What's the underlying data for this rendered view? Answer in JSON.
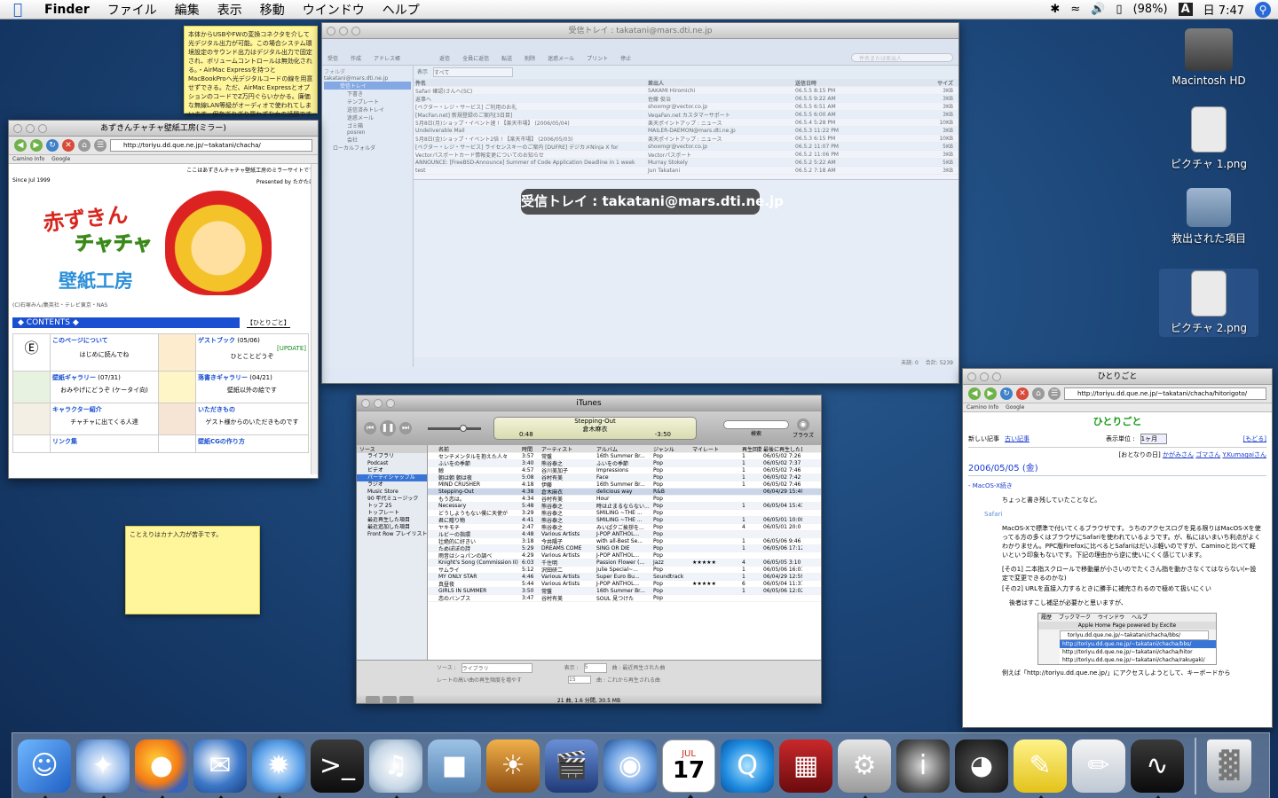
{
  "menubar": {
    "app_name": "Finder",
    "menus": [
      "ファイル",
      "編集",
      "表示",
      "移動",
      "ウインドウ",
      "ヘルプ"
    ],
    "battery": "(98%)",
    "input_mode": "A",
    "clock": "日 7:47"
  },
  "desktop_icons": [
    {
      "label": "Macintosh HD"
    },
    {
      "label": "ピクチャ 1.png"
    },
    {
      "label": "救出された項目"
    },
    {
      "label": "ピクチャ 2.png"
    }
  ],
  "sticky_top": {
    "text": "本体からUSBやFWの変換コネクタを介して光デジタル出力が可能。この場合システム環境設定のサウンド出力はデジタル出力で固定され、ボリュームコントロールは無効化される。・AirMac Expressを持つとMacBookProへ光デジタルコードの線を用意せずできる。ただ、AirMac ExpressとオプションのコードでZ万円ぐらいかかる。廉価な無線LAN等級がオーディオで使われてしまいます。保存ぎりぎり買わずな女の話題ですがが、そんなものです購入にはかなり後の残念です。"
  },
  "sticky_bottom": {
    "text": "ことえりはカナ入力が苦手です。"
  },
  "camino": {
    "title": "あずきんチャチャ壁紙工房(ミラー)",
    "url": "http://toriyu.dd.que.ne.jp/~takatani/chacha/",
    "bookmarks": [
      "Camino Info",
      "Google"
    ],
    "mirror_note": "ここはあずきんチャチャ壁紙工房のミラーサイトです",
    "since": "Since Jul 1999",
    "presented_by": "Presented by たかたに",
    "copyright": "(C)石塚みん/集英社・テレビ東京・NAS",
    "logo_line1": "赤ずきん",
    "logo_line2": "チャチャ",
    "logo_line3": "壁紙工房",
    "contents_label": "◆ CONTENTS ◆",
    "hitorigoto_link": "【ひとりごと】",
    "items": [
      {
        "title": "このページについて",
        "desc": "はじめに読んでね",
        "date": ""
      },
      {
        "title": "ゲストブック",
        "desc": "ひとことどうぞ",
        "date": "(05/06)",
        "badge": "[UPDATE]"
      },
      {
        "title": "壁紙ギャラリー",
        "desc": "おみやげにどうぞ (ケータイ向)",
        "date": "(07/31)"
      },
      {
        "title": "落書きギャラリー",
        "desc": "壁紙以外の絵です",
        "date": "(04/21)"
      },
      {
        "title": "キャラクター紹介",
        "desc": "チャチャに出てくる人達",
        "date": ""
      },
      {
        "title": "いただきもの",
        "desc": "ゲスト様からのいただきものです",
        "date": ""
      },
      {
        "title": "リンク集",
        "desc": "",
        "date": ""
      },
      {
        "title": "壁紙CGの作り方",
        "desc": "",
        "date": ""
      }
    ]
  },
  "mail": {
    "title": "受信トレイ : takatani@mars.dti.ne.jp",
    "toolbar": [
      "受信",
      "作成",
      "アドレス帳",
      "返信",
      "全員に返信",
      "転送",
      "削除",
      "迷惑メール",
      "プリント",
      "停止"
    ],
    "search_placeholder": "件名または差出人",
    "show_label": "表示",
    "show_value": "すべて",
    "folders": [
      "フォルダ",
      "takatani@mars.dti.ne.jp",
      "受信トレイ",
      "下書き",
      "テンプレート",
      "送信済みトレイ",
      "迷惑メール",
      "ゴミ箱",
      "posren",
      "会社",
      "ローカルフォルダ"
    ],
    "columns": [
      "件名",
      "差出人",
      "送信日時",
      "サイズ"
    ],
    "rows": [
      {
        "subject": "Safari 確認(さんへ(SC)",
        "from": "SAKAMI Hiromichi",
        "date": "06.5.5 8:15 PM",
        "size": "3KB"
      },
      {
        "subject": "返事へ",
        "from": "佐藤 俊治",
        "date": "06.5.5 9:22 AM",
        "size": "3KB"
      },
      {
        "subject": "[ベクター・レジ・サービス] ご利用のお礼",
        "from": "shoomgr@vector.co.jp",
        "date": "06.5.5 6:51 AM",
        "size": "3KB"
      },
      {
        "subject": "[MacFan.net] 新規登録のご案内[3日目]",
        "from": "VegaFan.net カスタマーサポート",
        "date": "06.5.5 6:00 AM",
        "size": "3KB"
      },
      {
        "subject": "5月8日(月)ショップ・イベント速 ! 【楽天市場】 (2006/05/04)",
        "from": "楽天ポイントアップ : ニュース",
        "date": "06.5.4 5:28 PM",
        "size": "10KB"
      },
      {
        "subject": "Undeliverable Mail",
        "from": "MAILER-DAEMON@mars.dti.ne.jp",
        "date": "06.5.3 11:22 PM",
        "size": "3KB"
      },
      {
        "subject": "5月8日(金)ショップ・イベント2倍 ! 【楽天市場】 (2006/05/03)",
        "from": "楽天ポイントアップ : ニュース",
        "date": "06.5.3 6:15 PM",
        "size": "10KB"
      },
      {
        "subject": "[ベクター・レジ・サービス] ライセンスキーのご案内 [DUFRE] デジカメNinja X for",
        "from": "shoomgr@vector.co.jp",
        "date": "06.5.2 11:07 PM",
        "size": "5KB"
      },
      {
        "subject": "Vectorパスポートカード情報変更についてのお知らせ",
        "from": "Vectorパスポート",
        "date": "06.5.2 11:06 PM",
        "size": "3KB"
      },
      {
        "subject": "ANNOUNCE: [FreeBSD-Announce] Summer of Code Application Deadline in 1 week",
        "from": "Murray Stokely",
        "date": "06.5.2 5:22 AM",
        "size": "5KB"
      },
      {
        "subject": "test",
        "from": "Jun Takatani",
        "date": "06.5.2 7:18 AM",
        "size": "3KB"
      }
    ],
    "status_unread": "未読: 0",
    "status_total": "合計: 5239"
  },
  "hud": {
    "text": "受信トレイ : takatani@mars.dti.ne.jp"
  },
  "itunes": {
    "title": "iTunes",
    "now_playing": "Stepping-Out",
    "now_artist": "倉木麻衣",
    "elapsed": "0:48",
    "remaining": "-3:50",
    "search_label": "検索",
    "browse_label": "ブラウズ",
    "source_header": "ソース",
    "sources": [
      "ライブラリ",
      "Podcast",
      "ビデオ",
      "パーティシャッフル",
      "ラジオ",
      "Music Store",
      "90 年代ミュージック",
      "トップ 25",
      "トップレート",
      "最近再生した項目",
      "最近追加した項目",
      "Front Row プレイリスト"
    ],
    "columns": [
      "名前",
      "時間",
      "アーティスト",
      "アルバム",
      "ジャンル",
      "マイレート",
      "再生回数",
      "最後に再生した日"
    ],
    "tracks": [
      {
        "name": "センチメンタルを抱えた人々",
        "time": "3:57",
        "artist": "常盤",
        "album": "16th Summer Br...",
        "genre": "Pop",
        "rating": "",
        "plays": "1",
        "last": "06/05/02 7:26"
      },
      {
        "name": "ふいをの季節",
        "time": "3:40",
        "artist": "熊谷泰之",
        "album": "ふいをの季節",
        "genre": "Pop",
        "rating": "",
        "plays": "1",
        "last": "06/05/02 7:37"
      },
      {
        "name": "鯨",
        "time": "4:57",
        "artist": "谷川美加子",
        "album": "Impressions",
        "genre": "Pop",
        "rating": "",
        "plays": "1",
        "last": "06/05/02 7:46"
      },
      {
        "name": "朝は朝 朝は夜",
        "time": "5:08",
        "artist": "谷村有美",
        "album": "Face",
        "genre": "Pop",
        "rating": "",
        "plays": "1",
        "last": "06/05/02 7:42"
      },
      {
        "name": "MIND CRUSHER",
        "time": "4:18",
        "artist": "伊藤",
        "album": "16th Summer Br...",
        "genre": "Pop",
        "rating": "",
        "plays": "1",
        "last": "06/05/02 7:46"
      },
      {
        "name": "Stepping-Out",
        "time": "4:38",
        "artist": "倉木麻衣",
        "album": "delicious way",
        "genre": "R&B",
        "rating": "",
        "plays": "",
        "last": "06/04/29 15:40"
      },
      {
        "name": "もう恋は。",
        "time": "4:34",
        "artist": "谷村有美",
        "album": "Hour",
        "genre": "Pop",
        "rating": "",
        "plays": "",
        "last": ""
      },
      {
        "name": "Necessary",
        "time": "5:48",
        "artist": "熊谷泰之",
        "album": "時は止まるならない...",
        "genre": "Pop",
        "rating": "",
        "plays": "1",
        "last": "06/05/04 15:43"
      },
      {
        "name": "どうしようもない僕に天使が",
        "time": "3:29",
        "artist": "熊谷泰之",
        "album": "SMILING ~THE ...",
        "genre": "Pop",
        "rating": "",
        "plays": "",
        "last": ""
      },
      {
        "name": "君に贈り物",
        "time": "4:41",
        "artist": "熊谷泰之",
        "album": "SMILING ~THE ...",
        "genre": "Pop",
        "rating": "",
        "plays": "1",
        "last": "06/05/01 10:00"
      },
      {
        "name": "ヤキモチ",
        "time": "2:47",
        "artist": "熊谷泰之",
        "album": "みいぱ夕ご挨拶を...",
        "genre": "Pop",
        "rating": "",
        "plays": "4",
        "last": "06/05/01 20:0"
      },
      {
        "name": "ルビーの指環",
        "time": "4:48",
        "artist": "Various Artists",
        "album": "J-POP ANTHOL...",
        "genre": "Pop",
        "rating": "",
        "plays": "",
        "last": ""
      },
      {
        "name": "壮絶的に好きい",
        "time": "3:18",
        "artist": "今井陽子",
        "album": "with all-Best Se...",
        "genre": "Pop",
        "rating": "",
        "plays": "1",
        "last": "06/05/06 9:46"
      },
      {
        "name": "ためぽぽの詩",
        "time": "5:29",
        "artist": "DREAMS COME",
        "album": "SING OR DIE",
        "genre": "Pop",
        "rating": "",
        "plays": "1",
        "last": "06/05/06 17:12"
      },
      {
        "name": "雨音はショパンの調べ",
        "time": "4:29",
        "artist": "Various Artists",
        "album": "J-POP ANTHOL...",
        "genre": "Pop",
        "rating": "",
        "plays": "",
        "last": ""
      },
      {
        "name": "Knight's Song (Commission II)",
        "time": "6:03",
        "artist": "千住明",
        "album": "Passion Flower (...",
        "genre": "Jazz",
        "rating": "★★★★★",
        "plays": "4",
        "last": "06/05/05 3:10"
      },
      {
        "name": "サムライ",
        "time": "5:12",
        "artist": "沢田研二",
        "album": "Julie Special~...",
        "genre": "Pop",
        "rating": "",
        "plays": "1",
        "last": "06/05/06 16:01"
      },
      {
        "name": "MY ONLY STAR",
        "time": "4:46",
        "artist": "Various Artists",
        "album": "Super Euro Bu...",
        "genre": "Soundtrack",
        "rating": "",
        "plays": "1",
        "last": "06/04/29 12:59"
      },
      {
        "name": "真昼夜",
        "time": "5:44",
        "artist": "Various Artists",
        "album": "J-POP ANTHOL...",
        "genre": "Pop",
        "rating": "★★★★★",
        "plays": "6",
        "last": "06/05/04 11:37"
      },
      {
        "name": "GIRLS IN SUMMER",
        "time": "3:50",
        "artist": "常盤",
        "album": "16th Summer Br...",
        "genre": "Pop",
        "rating": "",
        "plays": "1",
        "last": "06/05/06 12:02"
      },
      {
        "name": "恋のバンプス",
        "time": "3:47",
        "artist": "谷村有美",
        "album": "SOUL 見つけた",
        "genre": "Pop",
        "rating": "",
        "plays": "",
        "last": ""
      }
    ],
    "source_label": "ソース :",
    "source_value": "ライブラリ",
    "display_label": "表示 :",
    "display_value": "5",
    "played_label": "曲 : 最近再生された曲",
    "upnext_value": "15",
    "upnext_label": "曲 : これから再生される曲",
    "shuffle_label": "レートの高い曲の再生頻度を増やす",
    "footer": "21 曲, 1.6 分間, 30.5 MB"
  },
  "safari": {
    "title": "ひとりごと",
    "url": "http://toriyu.dd.que.ne.jp/~takatani/chacha/hitorigoto/",
    "bookmarks": [
      "Camino Info",
      "Google"
    ],
    "heading": "ひとりごと",
    "newest_label": "新しい記事",
    "older_link": "古い記事",
    "display_unit_label": "表示単位 :",
    "display_unit_value": "1ヶ月",
    "back_link": "[もどる]",
    "friends_label": "[おとなりの日]",
    "friends": [
      "かがみさん",
      "ゴマさん",
      "Y.Kumagaiさん"
    ],
    "date": "2006/05/05 (金)",
    "section": "MacOS-X続き",
    "intro": "ちょっと書き残していたことなど。",
    "subsection": "Safari",
    "para1": "MacOS-Xで標準で付いてくるブラウザです。うちのアクセスログを見る限りはMacOS-Xを使ってる方の多くはブラウザにSafariを使われているようです。が、私にはいまいち利点がよくわかりません。PPC版Firefoxに比べるとSafariはだいぶ軽いのですが、Caminoと比べて軽いという印象もないです。下記の理由から逆に使いにくく感じています。",
    "note1": "[その1] 二本指スクロールで移動量が小さいのでたくさん指を動かさなくてはならない(←設定で変更できるのかな)",
    "note2": "[その2] URLを直接入力するときに勝手に補完されるので極めて扱いにくい",
    "para2": "後者はすこし補足が必要かと思いますが、",
    "inset_menu": [
      "履歴",
      "ブックマーク",
      "ウインドウ",
      "ヘルプ"
    ],
    "inset_title": "Apple Home Page powered by Excite",
    "inset_url": "toriyu.dd.que.ne.jp/~takatani/chacha/bbs/",
    "inset_suggestions": [
      "http://toriyu.dd.que.ne.jp/~takatani/chacha/bbs/",
      "http://toriyu.dd.que.ne.jp/~takatani/chacha/hitor",
      "http://toriyu.dd.que.ne.jp/~takatani/chacha/rakugaki/"
    ],
    "para3": "例えば「http://toriyu.dd.que.ne.jp/」にアクセスしようとして、キーボードから"
  },
  "dock": [
    "Finder",
    "Camino",
    "Firefox",
    "Thunderbird",
    "Safari",
    "ターミナル",
    "iTunes",
    "プレビュー",
    "iPhoto",
    "iMovie",
    "DVD プレーヤー",
    "iCal",
    "QuickTime Player",
    "Photo Booth",
    "システム環境設定",
    "情報",
    "Dashboard",
    "スティッキーズ",
    "テキストエディット",
    "アクティビティモニタ",
    "ゴミ箱"
  ],
  "dock_date": {
    "month": "JUL",
    "day": "17"
  },
  "colors": {
    "accent": "#3875d7",
    "sticky": "#fff59a",
    "contents_bar": "#1a4fd1"
  }
}
